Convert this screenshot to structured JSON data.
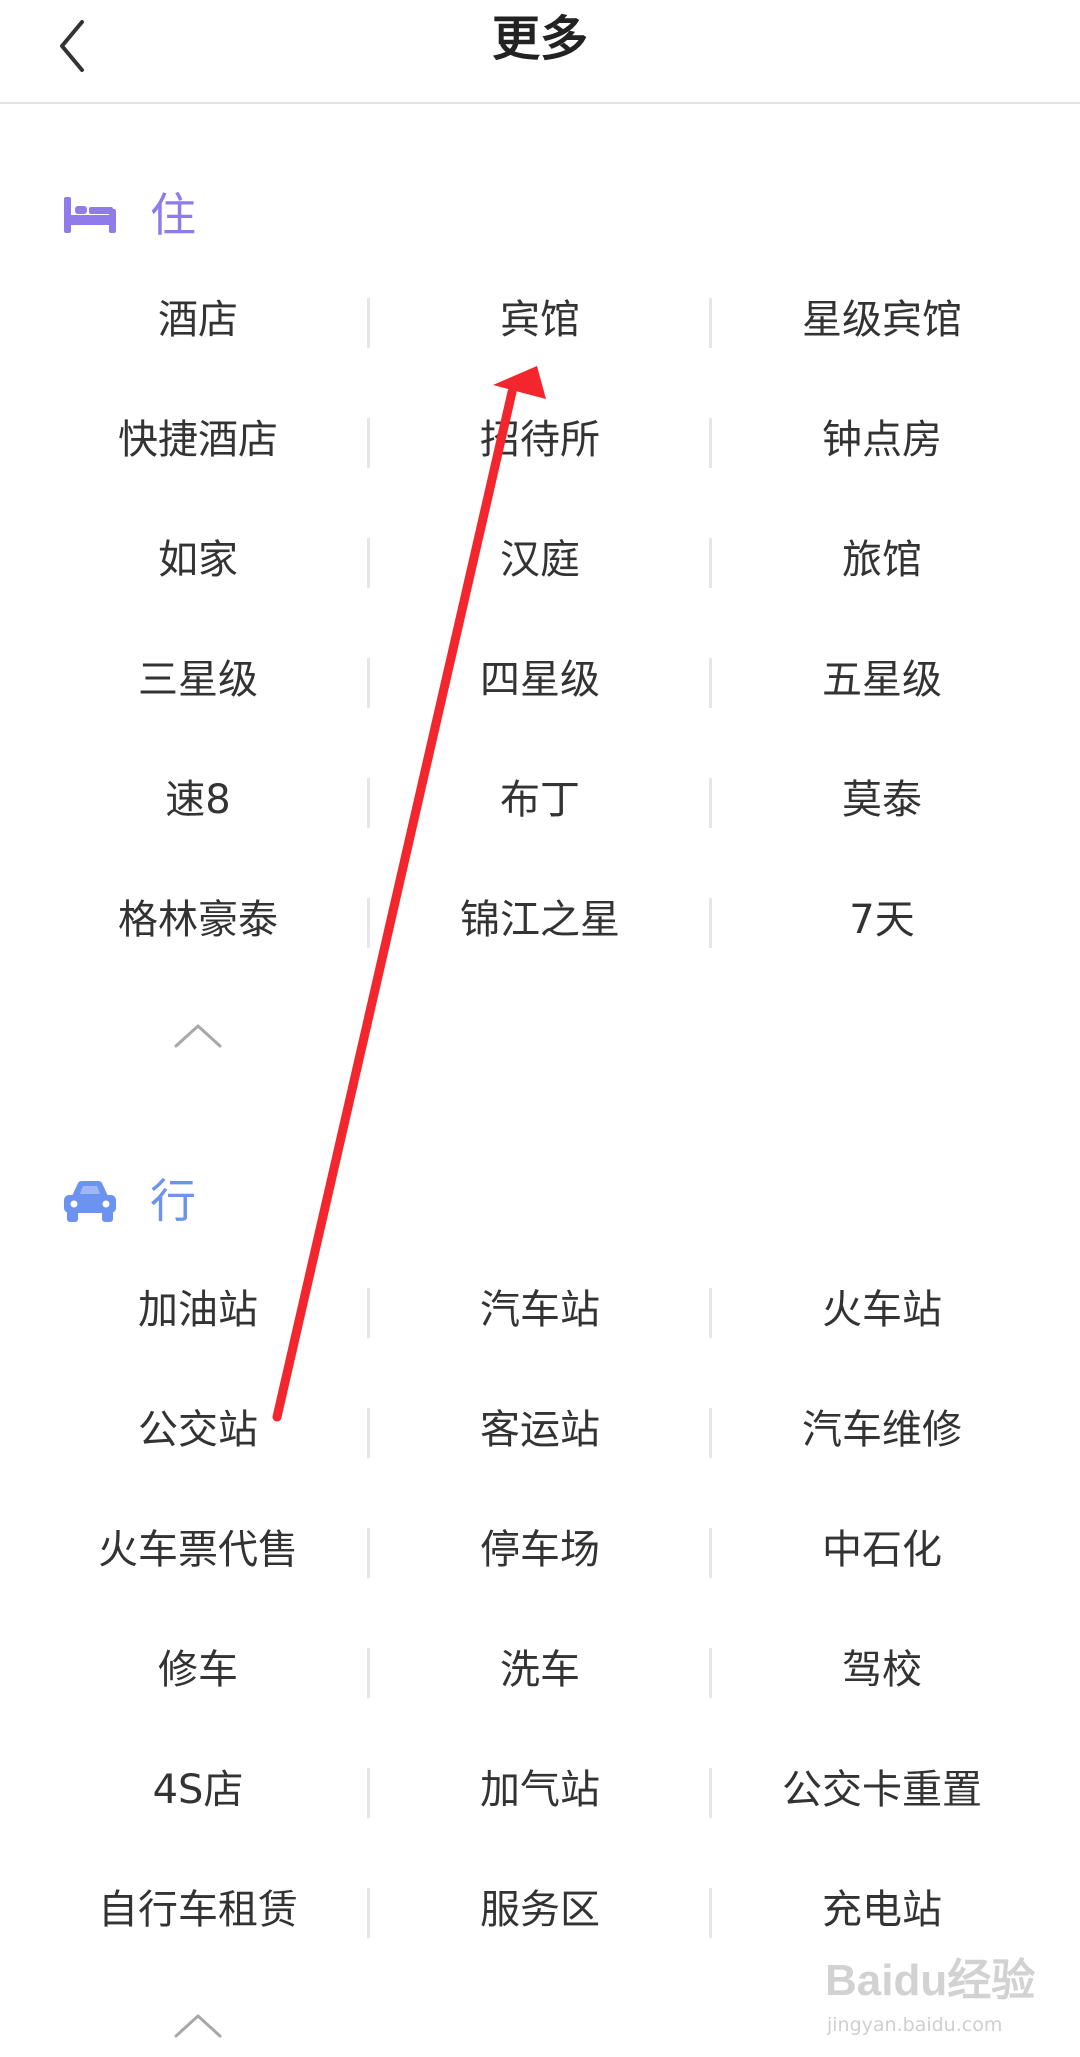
{
  "header": {
    "title": "更多"
  },
  "sections": [
    {
      "label": "住",
      "icon": "bed-icon",
      "items": [
        "酒店",
        "宾馆",
        "星级宾馆",
        "快捷酒店",
        "招待所",
        "钟点房",
        "如家",
        "汉庭",
        "旅馆",
        "三星级",
        "四星级",
        "五星级",
        "速8",
        "布丁",
        "莫泰",
        "格林豪泰",
        "锦江之星",
        "7天"
      ]
    },
    {
      "label": "行",
      "icon": "car-icon",
      "items": [
        "加油站",
        "汽车站",
        "火车站",
        "公交站",
        "客运站",
        "汽车维修",
        "火车票代售",
        "停车场",
        "中石化",
        "修车",
        "洗车",
        "驾校",
        "4S店",
        "加气站",
        "公交卡重置",
        "自行车租赁",
        "服务区",
        "充电站"
      ]
    }
  ],
  "watermark": {
    "brand": "Baidu经验",
    "url": "jingyan.baidu.com"
  },
  "colors": {
    "accent_stay": "#8f7bea",
    "accent_travel": "#6c93f0",
    "annotation_arrow": "#f2262c"
  }
}
